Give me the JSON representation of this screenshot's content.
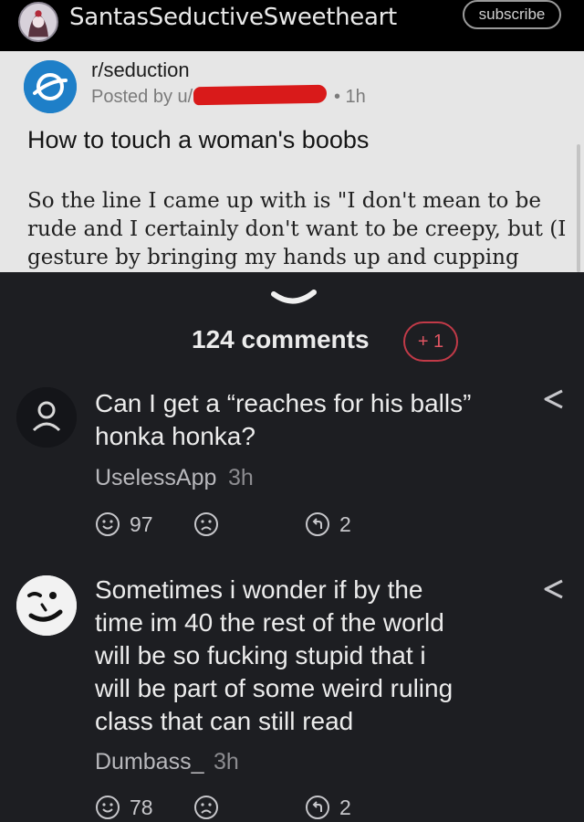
{
  "header": {
    "channel_name": "SantasSeductiveSweetheart",
    "subscribe_label": "subscribe"
  },
  "post": {
    "subreddit": "r/seduction",
    "posted_prefix": "Posted by u/",
    "posted_time": "• 1h",
    "title": "How to touch a woman's boobs",
    "body": "So the line I came up with is \"I don't mean to be rude and I certainly don't want to be creepy, but (I gesture by bringing my hands up and cupping"
  },
  "comments_header": {
    "count_label": "124 comments",
    "new_badge": "+ 1"
  },
  "comments": [
    {
      "text_lines": [
        "Can I get a “reaches for his balls”",
        "honka honka?"
      ],
      "author": "UselessApp",
      "time": "3h",
      "likes": "97",
      "replies": "2"
    },
    {
      "text_lines": [
        "Sometimes i wonder if by the",
        "time im 40 the rest of the world",
        "will be so fucking stupid that i",
        "will be part of some weird ruling",
        "class that can still read"
      ],
      "author": "Dumbass_",
      "time": "3h",
      "likes": "78",
      "replies": "2"
    }
  ],
  "icons": {
    "like": "smile-icon",
    "dislike": "frown-icon",
    "reply": "reply-icon",
    "share": "share-icon",
    "expand": "chevron-down-icon"
  },
  "colors": {
    "page_bg": "#1d1e22",
    "post_bg": "#e6e6e6",
    "accent_red": "#c23a48",
    "redaction": "#d91a1a",
    "subreddit_blue": "#1e7fc8"
  }
}
